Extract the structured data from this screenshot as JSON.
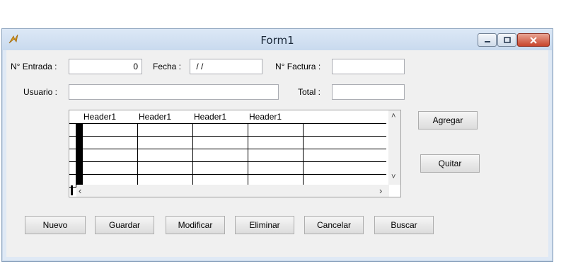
{
  "window": {
    "title": "Form1"
  },
  "fields": {
    "entrada_label": "N° Entrada :",
    "entrada_value": "0",
    "fecha_label": "Fecha :",
    "fecha_value": " / /",
    "factura_label": "N° Factura :",
    "factura_value": "",
    "usuario_label": "Usuario :",
    "usuario_value": "",
    "total_label": "Total :",
    "total_value": ""
  },
  "grid": {
    "headers": [
      "Header1",
      "Header1",
      "Header1",
      "Header1"
    ],
    "rows": [
      [
        "",
        "",
        "",
        "",
        ""
      ],
      [
        "",
        "",
        "",
        "",
        ""
      ],
      [
        "",
        "",
        "",
        "",
        ""
      ],
      [
        "",
        "",
        "",
        "",
        ""
      ],
      [
        "",
        "",
        "",
        "",
        ""
      ]
    ]
  },
  "side_buttons": {
    "agregar": "Agregar",
    "quitar": "Quitar"
  },
  "bottom_buttons": {
    "nuevo": "Nuevo",
    "guardar": "Guardar",
    "modificar": "Modificar",
    "eliminar": "Eliminar",
    "cancelar": "Cancelar",
    "buscar": "Buscar"
  },
  "icons": {
    "app": "app-logo-icon",
    "minimize": "minimize-icon",
    "maximize": "maximize-icon",
    "close": "close-icon"
  }
}
